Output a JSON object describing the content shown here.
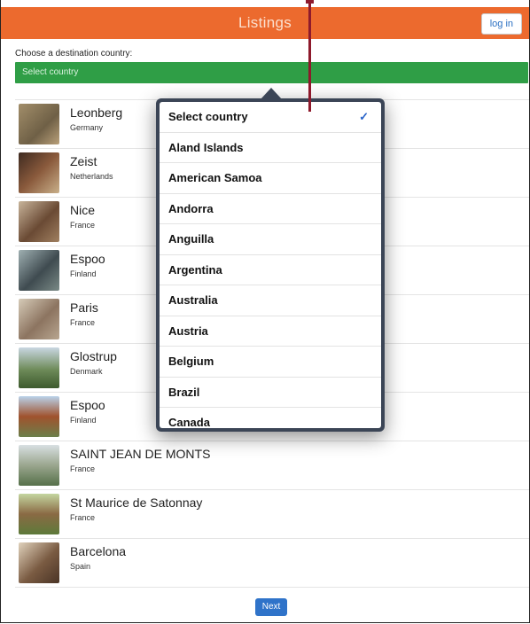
{
  "header": {
    "title": "Listings",
    "login_label": "log in"
  },
  "search": {
    "label": "Choose a destination country:",
    "select_value": "Select country"
  },
  "listings": [
    {
      "city": "Leonberg",
      "country": "Germany",
      "thumb_color": "#8c7a5a"
    },
    {
      "city": "Zeist",
      "country": "Netherlands",
      "thumb_color": "#6b4a38"
    },
    {
      "city": "Nice",
      "country": "France",
      "thumb_color": "#8a6a52"
    },
    {
      "city": "Espoo",
      "country": "Finland",
      "thumb_color": "#5f6d72"
    },
    {
      "city": "Paris",
      "country": "France",
      "thumb_color": "#9a8a78"
    },
    {
      "city": "Glostrup",
      "country": "Denmark",
      "thumb_color": "#4e6b3e"
    },
    {
      "city": "Espoo",
      "country": "Finland",
      "thumb_color": "#8a5e40"
    },
    {
      "city": "SAINT JEAN DE MONTS",
      "country": "France",
      "thumb_color": "#6e7f64"
    },
    {
      "city": "St Maurice de Satonnay",
      "country": "France",
      "thumb_color": "#7d8a56"
    },
    {
      "city": "Barcelona",
      "country": "Spain",
      "thumb_color": "#7a5b42"
    }
  ],
  "dropdown": {
    "selected": "Select country",
    "options": [
      "Select country",
      "Aland Islands",
      "American Samoa",
      "Andorra",
      "Anguilla",
      "Argentina",
      "Australia",
      "Austria",
      "Belgium",
      "Brazil",
      "Canada"
    ],
    "check_icon": "checkmark-icon"
  },
  "footer": {
    "next_label": "Next"
  },
  "colors": {
    "topbar": "#ec6a2e",
    "select_bar": "#2f9e46",
    "next_button": "#2f73c9",
    "pointer": "#8e1a2c"
  }
}
